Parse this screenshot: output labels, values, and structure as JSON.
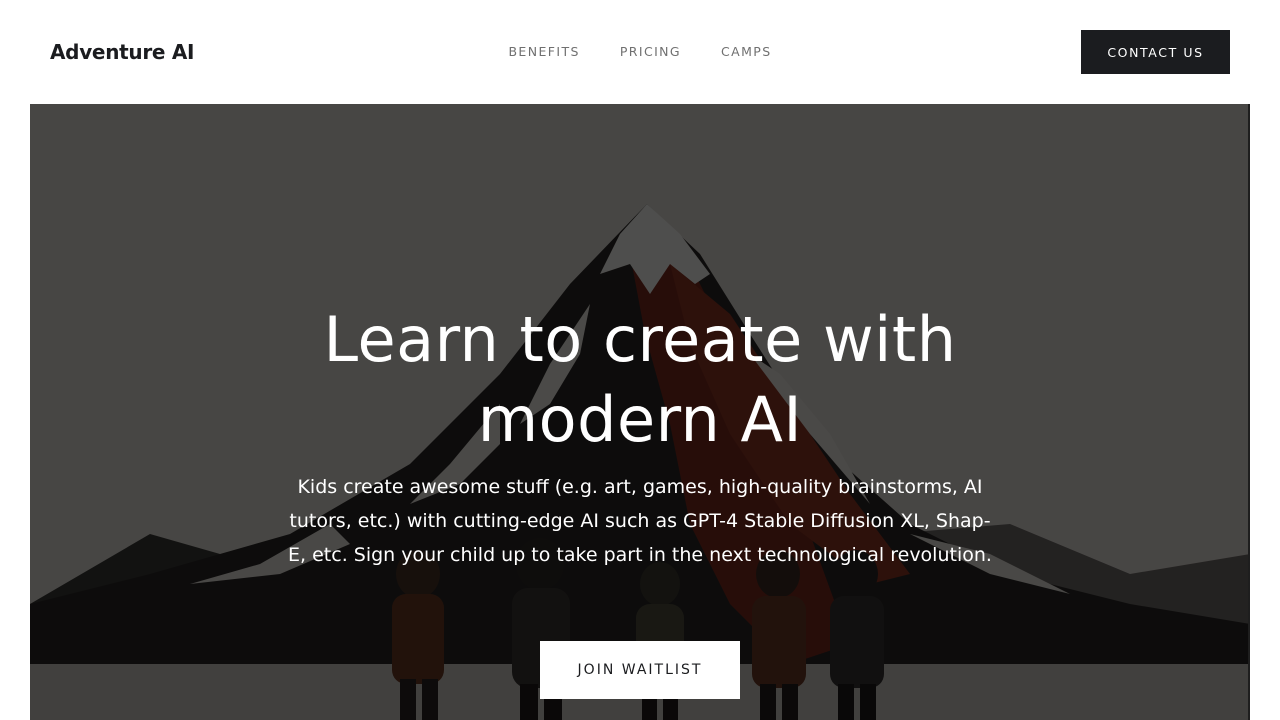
{
  "header": {
    "logo": "Adventure AI",
    "nav": [
      {
        "label": "BENEFITS"
      },
      {
        "label": "PRICING"
      },
      {
        "label": "CAMPS"
      }
    ],
    "contact_label": "CONTACT US"
  },
  "hero": {
    "title": "Learn to create with modern AI",
    "subtitle": "Kids create awesome stuff (e.g. art, games, high-quality brainstorms, AI tutors, etc.) with cutting-edge AI such as GPT-4 Stable Diffusion XL, Shap-E, etc. Sign your child up to take part in the next technological revolution.",
    "cta_label": "JOIN WAITLIST",
    "background_image": "mountain-with-children-illustration"
  },
  "colors": {
    "primary_dark": "#1b1c1f",
    "nav_text": "#707070",
    "hero_text": "#ffffff",
    "overlay": "rgba(0,0,0,0.68)"
  }
}
